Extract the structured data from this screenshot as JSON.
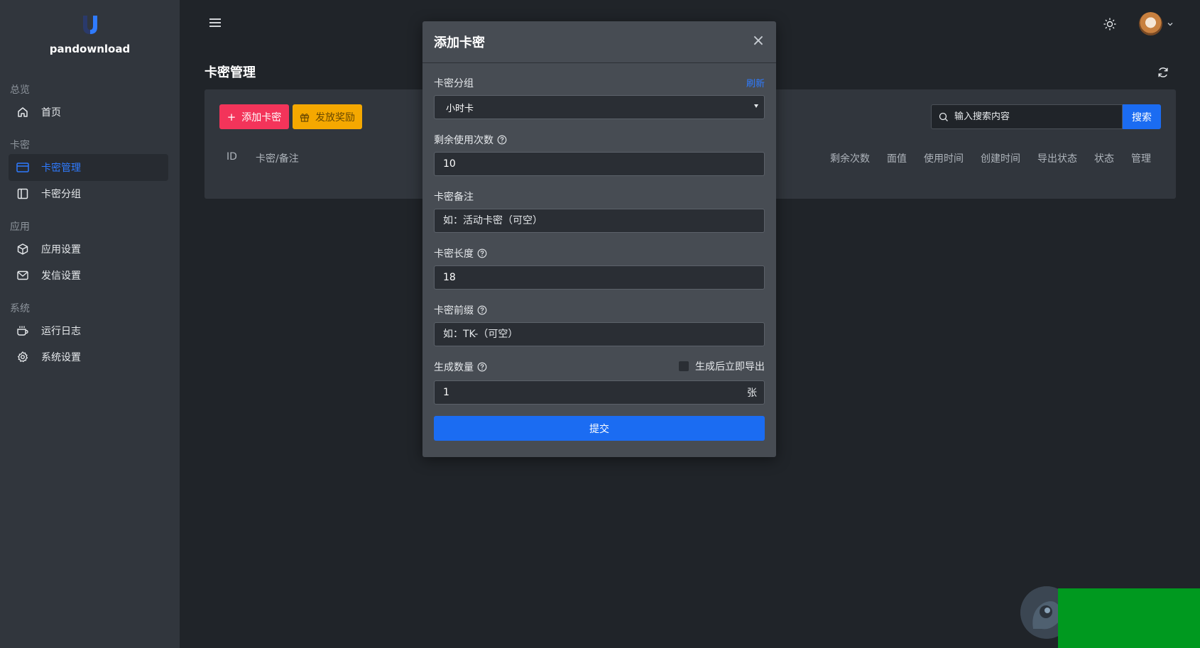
{
  "brand": {
    "name": "pandownload"
  },
  "sidebar": {
    "sections": [
      {
        "title": "总览",
        "items": [
          {
            "label": "首页",
            "icon": "home-icon"
          }
        ]
      },
      {
        "title": "卡密",
        "items": [
          {
            "label": "卡密管理",
            "icon": "card-icon",
            "active": true
          },
          {
            "label": "卡密分组",
            "icon": "panel-icon"
          }
        ]
      },
      {
        "title": "应用",
        "items": [
          {
            "label": "应用设置",
            "icon": "cube-icon"
          },
          {
            "label": "发信设置",
            "icon": "mail-icon"
          }
        ]
      },
      {
        "title": "系统",
        "items": [
          {
            "label": "运行日志",
            "icon": "cup-icon"
          },
          {
            "label": "系统设置",
            "icon": "gear-icon"
          }
        ]
      }
    ]
  },
  "page": {
    "title": "卡密管理"
  },
  "toolbar": {
    "add_label": "添加卡密",
    "reward_label": "发放奖励",
    "search_placeholder": "输入搜索内容",
    "search_button": "搜索"
  },
  "table": {
    "headers": [
      "ID",
      "卡密/备注",
      "剩余次数",
      "面值",
      "使用时间",
      "创建时间",
      "导出状态",
      "状态",
      "管理"
    ]
  },
  "modal": {
    "title": "添加卡密",
    "close_symbol": "×",
    "group_label": "卡密分组",
    "refresh_label": "刷新",
    "group_value": "小时卡",
    "remaining_label": "剩余使用次数",
    "remaining_value": "10",
    "note_label": "卡密备注",
    "note_placeholder": "如：活动卡密（可空）",
    "length_label": "卡密长度",
    "length_value": "18",
    "prefix_label": "卡密前缀",
    "prefix_placeholder": "如：TK-（可空）",
    "count_label": "生成数量",
    "export_checkbox_label": "生成后立即导出",
    "count_value": "1",
    "count_unit": "张",
    "submit_label": "提交"
  },
  "colors": {
    "accent": "#1b6cf2",
    "danger": "#f3345a",
    "warning": "#f5a800",
    "sidebar_bg": "#31363d",
    "page_bg": "#202429"
  }
}
